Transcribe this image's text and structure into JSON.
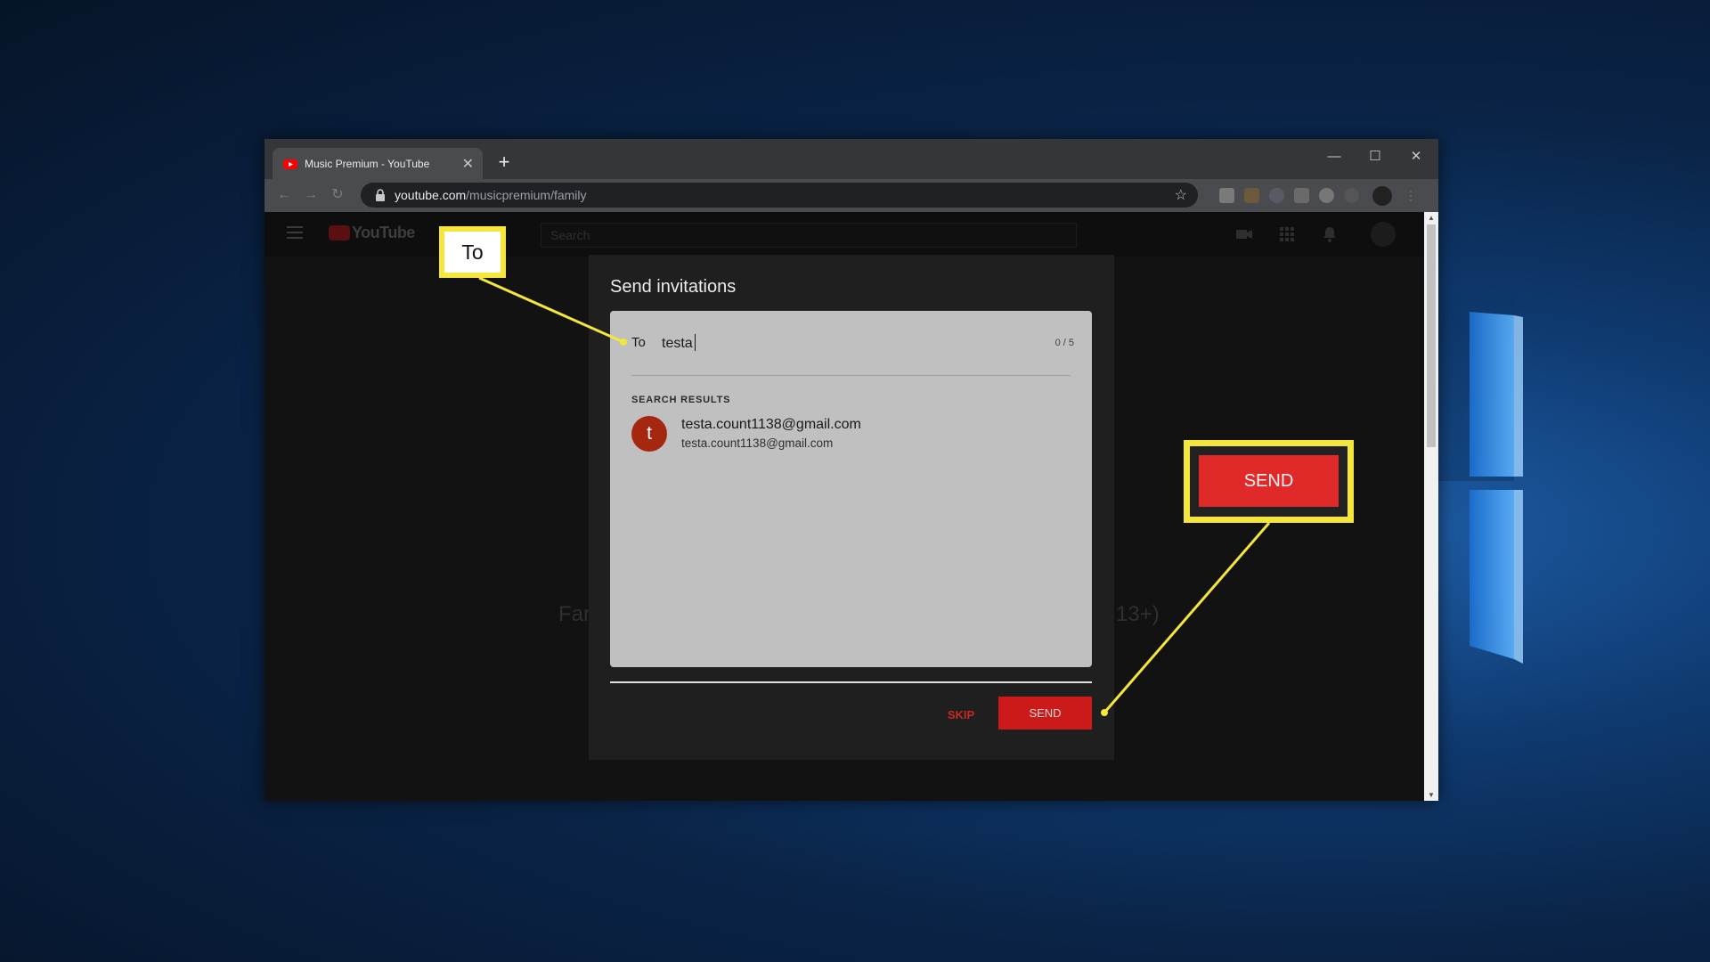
{
  "browser": {
    "tab_title": "Music Premium - YouTube",
    "url_host": "youtube.com",
    "url_path": "/musicpremium/family"
  },
  "youtube": {
    "logo_text": "YouTube",
    "search_placeholder": "Search",
    "background_text_left": "Far",
    "background_text_right": "13+)"
  },
  "dialog": {
    "title": "Send invitations",
    "to_label": "To",
    "to_value": "testa",
    "counter": "0 / 5",
    "search_results_heading": "SEARCH RESULTS",
    "results": [
      {
        "avatar_letter": "t",
        "primary": "testa.count1138@gmail.com",
        "secondary": "testa.count1138@gmail.com"
      }
    ],
    "skip_label": "SKIP",
    "send_label": "SEND"
  },
  "callouts": {
    "to_label": "To",
    "send_label": "SEND"
  },
  "colors": {
    "accent_red": "#cc1a1a",
    "callout_yellow": "#f5e63b",
    "avatar_bg": "#a6270f"
  },
  "icons": [
    "youtube-favicon",
    "lock-icon",
    "star-icon",
    "video-camera-icon",
    "apps-grid-icon",
    "bell-icon"
  ]
}
